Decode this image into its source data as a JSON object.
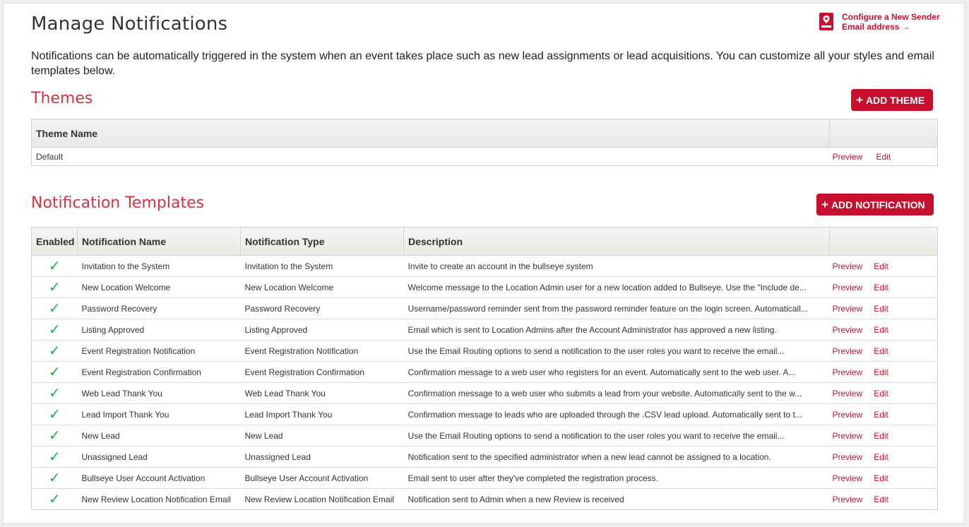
{
  "page": {
    "title": "Manage Notifications",
    "intro": "Notifications can be automatically triggered in the system when an event takes place such as new lead assignments or lead acquisitions. You can customize all your styles and email templates below.",
    "sender_link_line1": "Configure a New Sender",
    "sender_link_line2": "Email address →",
    "accent_color": "#c8102e"
  },
  "themes": {
    "title": "Themes",
    "add_button": "ADD THEME",
    "header_name": "Theme Name",
    "rows": [
      {
        "name": "Default",
        "preview": "Preview",
        "edit": "Edit"
      }
    ]
  },
  "templates": {
    "title": "Notification Templates",
    "add_button": "ADD NOTIFICATION",
    "headers": {
      "enabled": "Enabled",
      "name": "Notification Name",
      "type": "Notification Type",
      "description": "Description"
    },
    "rows": [
      {
        "enabled": "✓",
        "name": "Invitation to the System",
        "type": "Invitation to the System",
        "description": "Invite to create an account in the bullseye system",
        "preview": "Preview",
        "edit": "Edit"
      },
      {
        "enabled": "✓",
        "name": "New Location Welcome",
        "type": "New Location Welcome",
        "description": "Welcome message to the Location Admin user for a new location added to Bullseye. Use the \"Include de...",
        "preview": "Preview",
        "edit": "Edit"
      },
      {
        "enabled": "✓",
        "name": "Password Recovery",
        "type": "Password Recovery",
        "description": "Username/password reminder sent from the password reminder feature on the login screen. Automaticall...",
        "preview": "Preview",
        "edit": "Edit"
      },
      {
        "enabled": "✓",
        "name": "Listing Approved",
        "type": "Listing Approved",
        "description": "Email which is sent to Location Admins after the Account Administrator has approved a new listing.",
        "preview": "Preview",
        "edit": "Edit"
      },
      {
        "enabled": "✓",
        "name": "Event Registration Notification",
        "type": "Event Registration Notification",
        "description": "Use the Email Routing options to send a notification to the user roles you want to receive the email...",
        "preview": "Preview",
        "edit": "Edit"
      },
      {
        "enabled": "✓",
        "name": "Event Registration Confirmation",
        "type": "Event Registration Confirmation",
        "description": "Confirmation message to a web user who registers for an event. Automatically sent to the web user. A...",
        "preview": "Preview",
        "edit": "Edit"
      },
      {
        "enabled": "✓",
        "name": "Web Lead Thank You",
        "type": "Web Lead Thank You",
        "description": "Confirmation message to a web user who submits a lead from your website. Automatically sent to the w...",
        "preview": "Preview",
        "edit": "Edit"
      },
      {
        "enabled": "✓",
        "name": "Lead Import Thank You",
        "type": "Lead Import Thank You",
        "description": "Confirmation message to leads who are uploaded through the .CSV lead upload. Automatically sent to t...",
        "preview": "Preview",
        "edit": "Edit"
      },
      {
        "enabled": "✓",
        "name": "New Lead",
        "type": "New Lead",
        "description": "Use the Email Routing options to send a notification to the user roles you want to receive the email...",
        "preview": "Preview",
        "edit": "Edit"
      },
      {
        "enabled": "✓",
        "name": "Unassigned Lead",
        "type": "Unassigned Lead",
        "description": "Notification sent to the specified administrator when a new lead cannot be assigned to a location.",
        "preview": "Preview",
        "edit": "Edit"
      },
      {
        "enabled": "✓",
        "name": "Bullseye User Account Activation",
        "type": "Bullseye User Account Activation",
        "description": "Email sent to user after they've completed the registration process.",
        "preview": "Preview",
        "edit": "Edit"
      },
      {
        "enabled": "✓",
        "name": "New Review Location Notification Email",
        "type": "New Review Location Notification Email",
        "description": "Notification sent to Admin when a new Review is received",
        "preview": "Preview",
        "edit": "Edit"
      }
    ]
  }
}
